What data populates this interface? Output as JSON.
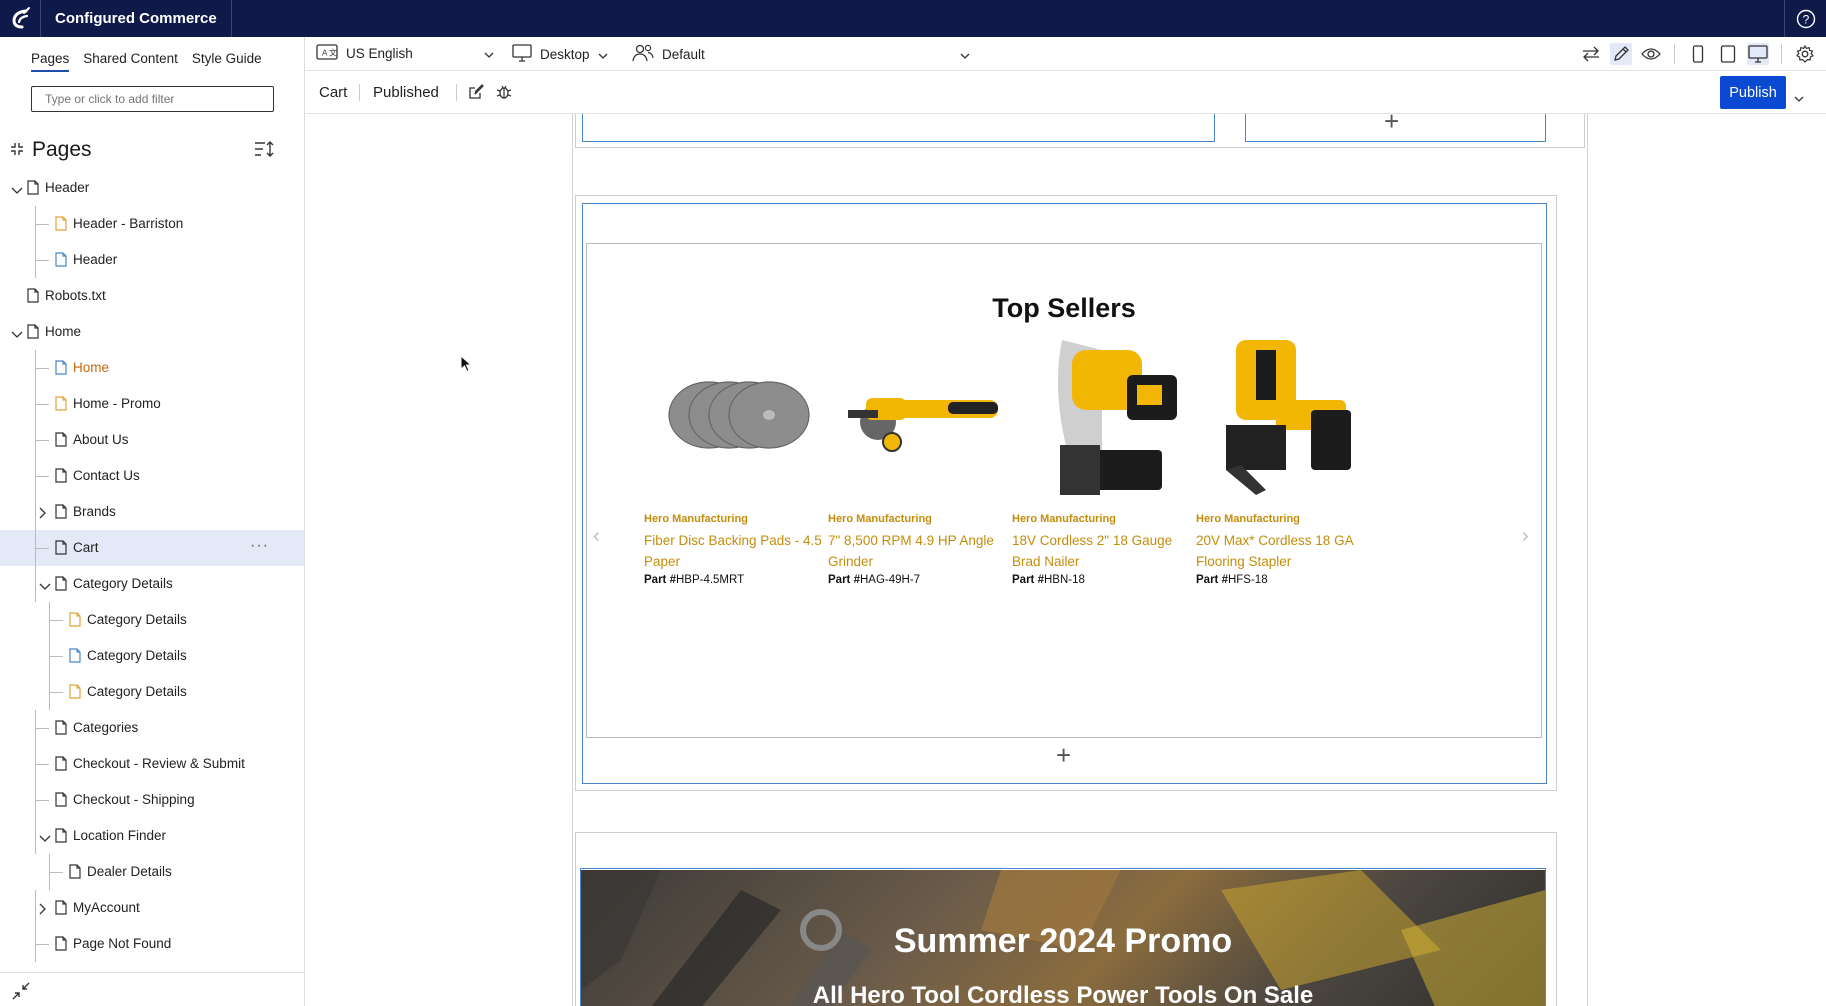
{
  "app": {
    "name": "Configured Commerce"
  },
  "sidebar": {
    "tabs": [
      "Pages",
      "Shared Content",
      "Style Guide"
    ],
    "filter_placeholder": "Type or click to add filter",
    "title": "Pages",
    "tree": [
      {
        "label": "Header",
        "depth": 0,
        "expander": "open",
        "color": "default"
      },
      {
        "label": "Header - Barriston",
        "depth": 1,
        "expander": "none",
        "color": "orange-icon"
      },
      {
        "label": "Header",
        "depth": 1,
        "expander": "none",
        "color": "blue-icon"
      },
      {
        "label": "Robots.txt",
        "depth": 0,
        "expander": "none",
        "color": "default"
      },
      {
        "label": "Home",
        "depth": 0,
        "expander": "open",
        "color": "default"
      },
      {
        "label": "Home",
        "depth": 1,
        "expander": "none",
        "color": "orange-label"
      },
      {
        "label": "Home - Promo",
        "depth": 1,
        "expander": "none",
        "color": "orange-icon"
      },
      {
        "label": "About Us",
        "depth": 1,
        "expander": "none",
        "color": "default"
      },
      {
        "label": "Contact Us",
        "depth": 1,
        "expander": "none",
        "color": "default"
      },
      {
        "label": "Brands",
        "depth": 1,
        "expander": "closed",
        "color": "default"
      },
      {
        "label": "Cart",
        "depth": 1,
        "expander": "none",
        "color": "default",
        "selected": true
      },
      {
        "label": "Category Details",
        "depth": 1,
        "expander": "open",
        "color": "default"
      },
      {
        "label": "Category Details",
        "depth": 2,
        "expander": "none",
        "color": "orange-icon"
      },
      {
        "label": "Category Details",
        "depth": 2,
        "expander": "none",
        "color": "blue-icon"
      },
      {
        "label": "Category Details",
        "depth": 2,
        "expander": "none",
        "color": "orange-icon"
      },
      {
        "label": "Categories",
        "depth": 1,
        "expander": "none",
        "color": "default"
      },
      {
        "label": "Checkout - Review & Submit",
        "depth": 1,
        "expander": "none",
        "color": "default"
      },
      {
        "label": "Checkout - Shipping",
        "depth": 1,
        "expander": "none",
        "color": "default"
      },
      {
        "label": "Location Finder",
        "depth": 1,
        "expander": "open",
        "color": "default"
      },
      {
        "label": "Dealer Details",
        "depth": 2,
        "expander": "none",
        "color": "default"
      },
      {
        "label": "MyAccount",
        "depth": 1,
        "expander": "closed",
        "color": "default"
      },
      {
        "label": "Page Not Found",
        "depth": 1,
        "expander": "none",
        "color": "default"
      }
    ]
  },
  "toolbar": {
    "language": "US English",
    "device": "Desktop",
    "persona": "Default"
  },
  "subbar": {
    "page": "Cart",
    "status": "Published",
    "publish_label": "Publish"
  },
  "top_sellers": {
    "title": "Top Sellers",
    "part_label": "Part #",
    "products": [
      {
        "manufacturer": "Hero Manufacturing",
        "name": "Fiber Disc Backing Pads - 4.5 Paper",
        "part": "HBP-4.5MRT",
        "image": "discs"
      },
      {
        "manufacturer": "Hero Manufacturing",
        "name": "7\" 8,500 RPM 4.9 HP Angle Grinder",
        "part": "HAG-49H-7",
        "image": "grinder"
      },
      {
        "manufacturer": "Hero Manufacturing",
        "name": "18V Cordless 2\" 18 Gauge Brad Nailer",
        "part": "HBN-18",
        "image": "nailer"
      },
      {
        "manufacturer": "Hero Manufacturing",
        "name": "20V Max* Cordless 18 GA Flooring Stapler",
        "part": "HFS-18",
        "image": "stapler"
      }
    ]
  },
  "promo": {
    "title": "Summer 2024 Promo",
    "subtitle": "All Hero Tool Cordless Power Tools On Sale"
  },
  "colors": {
    "topbar": "#0f1a4b",
    "accent": "#0a49d1",
    "orange": "#c8670c",
    "gold": "#c38d0a",
    "selected_row": "#e4e9f7"
  }
}
